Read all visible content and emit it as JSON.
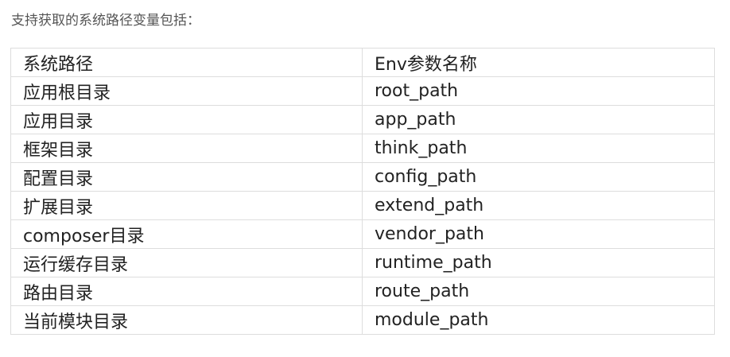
{
  "intro": "支持获取的系统路径变量包括：",
  "table": {
    "headers": [
      "系统路径",
      "Env参数名称"
    ],
    "rows": [
      [
        "应用根目录",
        "root_path"
      ],
      [
        "应用目录",
        "app_path"
      ],
      [
        "框架目录",
        "think_path"
      ],
      [
        "配置目录",
        "config_path"
      ],
      [
        "扩展目录",
        "extend_path"
      ],
      [
        "composer目录",
        "vendor_path"
      ],
      [
        "运行缓存目录",
        "runtime_path"
      ],
      [
        "路由目录",
        "route_path"
      ],
      [
        "当前模块目录",
        "module_path"
      ]
    ]
  }
}
